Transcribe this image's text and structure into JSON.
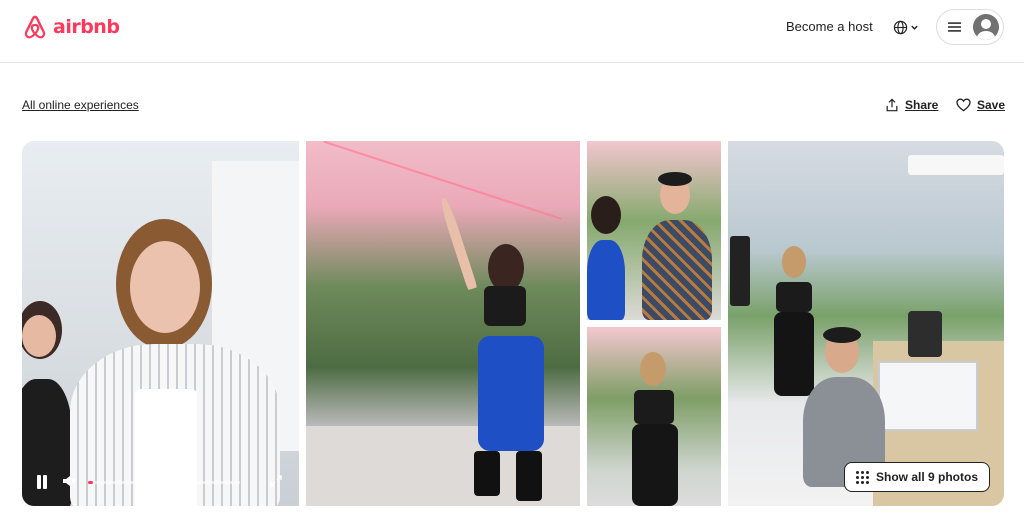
{
  "header": {
    "logo_text": "airbnb",
    "become_host_label": "Become a host",
    "language_icon": "globe-icon",
    "menu_icon": "hamburger-icon",
    "avatar_icon": "user-avatar-icon"
  },
  "subheader": {
    "back_link": "All online experiences",
    "share_label": "Share",
    "save_label": "Save"
  },
  "gallery": {
    "show_all_label": "Show all 9 photos",
    "video": {
      "progress": 0.03
    }
  },
  "colors": {
    "brand": "#ff385c",
    "text": "#222222",
    "border": "#dddddd"
  }
}
